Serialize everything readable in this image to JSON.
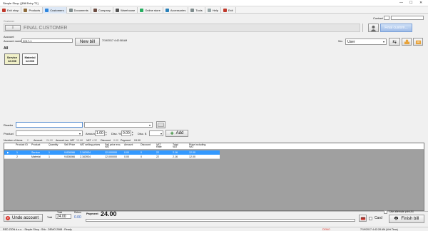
{
  "window": {
    "title": "Simple Shop | [Bill Entry T1]",
    "controls": [
      "—",
      "☐",
      "✕"
    ]
  },
  "menu": [
    {
      "label": "Exit shop",
      "color": "#c0392b",
      "active": false
    },
    {
      "label": "Products",
      "color": "#8e6b3a",
      "active": false
    },
    {
      "label": "Customers",
      "color": "#2e86de",
      "active": true
    },
    {
      "label": "Documents",
      "color": "#7f8c8d",
      "active": false
    },
    {
      "label": "Company",
      "color": "#6d4c41",
      "active": false
    },
    {
      "label": "Warehouse",
      "color": "#555555",
      "active": false
    },
    {
      "label": "Online store",
      "color": "#27ae60",
      "active": false
    },
    {
      "label": "Accessories",
      "color": "#2980b9",
      "active": false
    },
    {
      "label": "Tools",
      "color": "#7f8c8d",
      "active": false
    },
    {
      "label": "Help",
      "color": "#95a5a6",
      "active": false
    },
    {
      "label": "Exit",
      "color": "#c0392b",
      "active": false
    }
  ],
  "header": {
    "contact_label": "Contact",
    "customer_small_label": "Customer",
    "customer_name": "FINAL CUSTOMER",
    "final_customer_button": "Final custom..."
  },
  "bill": {
    "account_label": "Account",
    "account_number_label": "Account number",
    "account_number": "2017-1",
    "new_bill_button": "New bill",
    "datetime": "7/19/2017 4:42:08 AM",
    "user_label": "Sec.",
    "user_value": "User"
  },
  "products_panel": {
    "filter_label": "All",
    "items": [
      {
        "name": "Service",
        "price": "12.00€"
      },
      {
        "name": "Material",
        "price": "12.00€"
      }
    ]
  },
  "entry": {
    "reader_label": "Reader",
    "product_label": "Product",
    "amount_label": "Amount",
    "amount_value": "1.00",
    "disc_label": "Disc. %",
    "disc_value": "0.00",
    "disc_dollar_label": "Disc. $",
    "add_button": "Add"
  },
  "summary": {
    "number_of_items_label": "Number of items",
    "number_of_items": "2",
    "amount_label": "Amount",
    "amount_value": "24.00",
    "amount_wo_vat_label": "Amount wo. VAT",
    "amount_wo_vat": "19.68",
    "vat_label": "VAT",
    "vat_value": "4.32",
    "discount_label": "Discount",
    "discount_value": "0.00",
    "payment_label": "Payment",
    "payment_value": "24.00"
  },
  "table": {
    "columns": [
      "Product ID",
      "Product",
      "Quantity",
      "Sell Price",
      "VAT selling prices",
      "Sell price exc. VAT",
      "Amount",
      "Discount",
      "VAT Rate",
      "Total VAT",
      "Price including VAT"
    ],
    "rows": [
      {
        "marker": "▶",
        "n": "1",
        "cells": [
          "Service",
          "1",
          "9.836066",
          "2.163934",
          "12.000000",
          "0.00",
          "0",
          "22",
          "2.16",
          "12.00"
        ],
        "selected": true
      },
      {
        "marker": "",
        "n": "2",
        "cells": [
          "Material",
          "1",
          "9.836066",
          "2.163934",
          "12.000000",
          "0.00",
          "0",
          "22",
          "2.16",
          "12.00"
        ],
        "selected": false
      }
    ]
  },
  "footer": {
    "undo_button": "Undo account",
    "total_label": "Total",
    "total_value": "24.00",
    "return_label": "Return",
    "return_value": "0.00",
    "payment_label": "Payment",
    "payment_value": "24.00",
    "alt_print_label": "Use alternate print A4",
    "card_label": "Card",
    "finish_button": "Finish bill"
  },
  "status": {
    "left": "RED ZION d.o.o. · Simple Shop · Shk · DEMO 2068 · Ready",
    "demo": "DEMO",
    "datetime": "7/19/2017 4:42:28 AM (Wrt Time)"
  }
}
